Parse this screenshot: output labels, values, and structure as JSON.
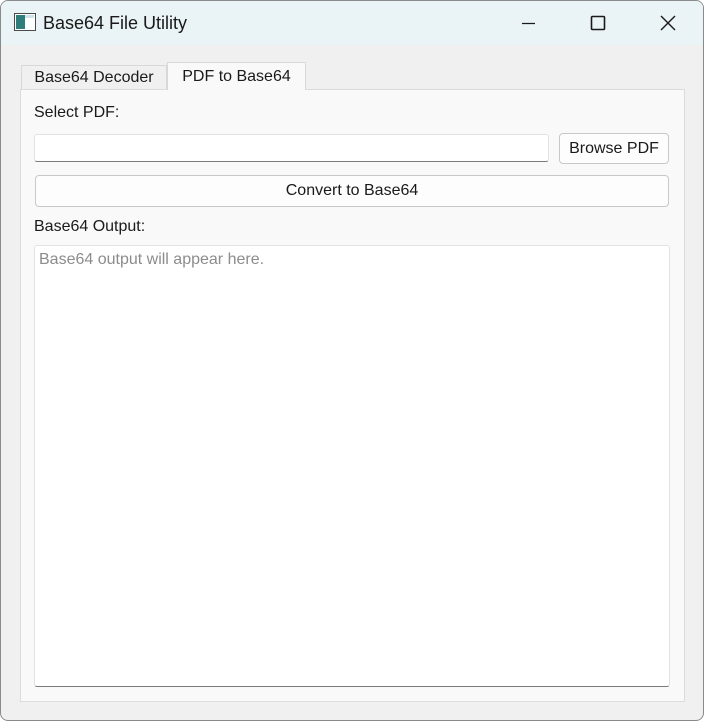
{
  "window": {
    "title": "Base64 File Utility",
    "app_icon": "app-window-icon",
    "controls": {
      "minimize_icon": "minimize-icon",
      "maximize_icon": "maximize-icon",
      "close_icon": "close-icon"
    }
  },
  "tabs": [
    {
      "label": "Base64 Decoder",
      "active": false
    },
    {
      "label": "PDF to Base64",
      "active": true
    }
  ],
  "pdf_panel": {
    "select_label": "Select PDF:",
    "pdf_path_value": "",
    "browse_label": "Browse PDF",
    "convert_label": "Convert to Base64",
    "output_label": "Base64 Output:",
    "output_value": "",
    "output_placeholder": "Base64 output will appear here."
  },
  "colors": {
    "titlebar": "#eaf3f6",
    "window_bg": "#f0f0f0",
    "panel_bg": "#f9f9f9"
  }
}
